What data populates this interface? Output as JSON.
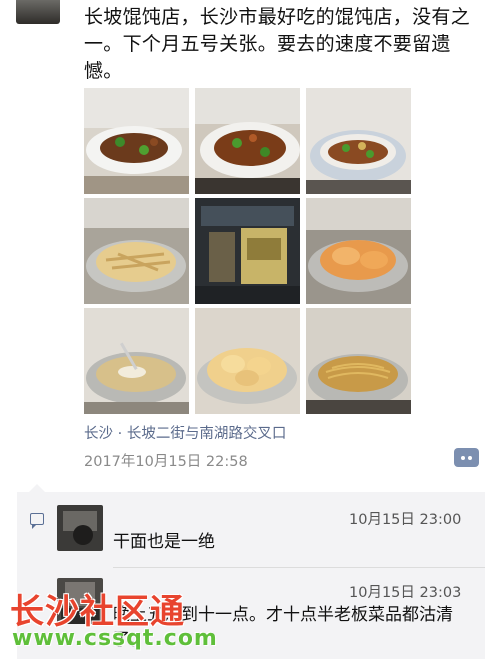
{
  "post": {
    "text": "长坡馄饨店，长沙市最好吃的馄饨店，没有之一。下个月五号关张。要去的速度不要留遗憾。",
    "location": "长沙 · 长坡二街与南湖路交叉口",
    "timestamp": "2017年10月15日 22:58",
    "photo_count": 9
  },
  "comments": [
    {
      "time": "10月15日 23:00",
      "text": "干面也是一绝"
    },
    {
      "time": "10月15日 23:03",
      "text": "晚上五点到十一点。才十点半老板菜品都沽清了。"
    }
  ],
  "watermark": {
    "title": "长沙社区通",
    "url": "www.cssqt.com"
  },
  "colors": {
    "link": "#5b6b8c",
    "comment_bg": "#f3f3f5",
    "more_button": "#7c8fb0",
    "watermark_red": "#e8442e",
    "watermark_green": "#5fbf3a"
  }
}
